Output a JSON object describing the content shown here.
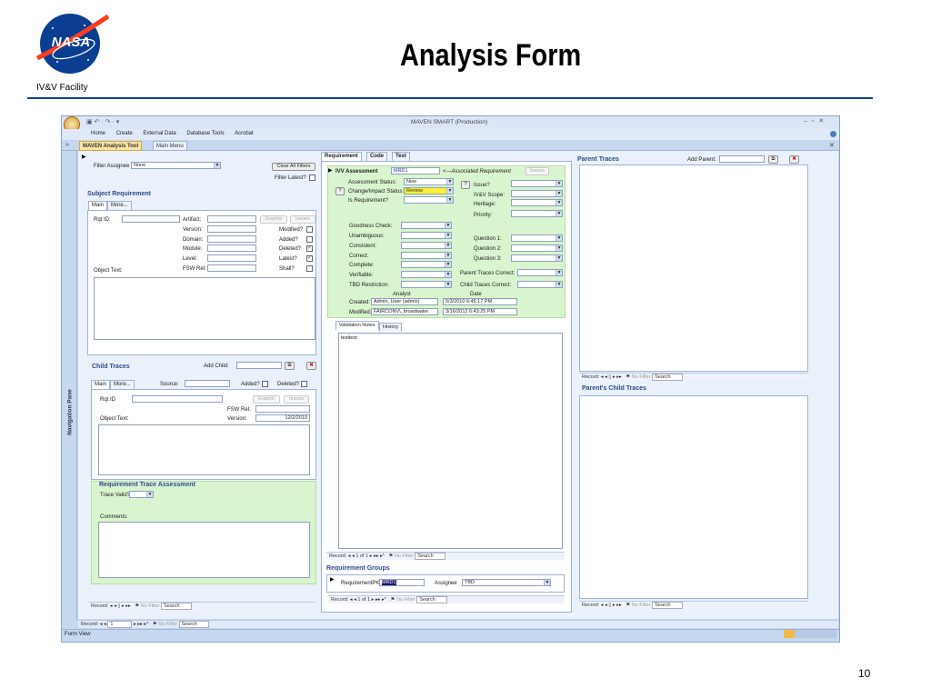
{
  "slide": {
    "title": "Analysis Form",
    "facility": "IV&V Facility",
    "logo_text": "NASA",
    "page_number": "10"
  },
  "app": {
    "window_title": "MAVEN SMART (Production)",
    "ribbon": [
      "Home",
      "Create",
      "External Data",
      "Database Tools",
      "Acrobat"
    ],
    "doc_tabs": [
      "MAVEN Analysis Tool",
      "Main Menu"
    ],
    "nav_pane": "Navigation Pane",
    "status": "Form View",
    "record_bar": {
      "label": "Record:",
      "value": "1",
      "filter": "No Filter",
      "search": "Search"
    }
  },
  "left": {
    "filter_assignee_label": "Filter Assignee",
    "filter_assignee_value": "None",
    "clear_filters": "Clear All Filters",
    "filter_latest": "Filter Latest?",
    "subject_title": "Subject Requirement",
    "tabs": [
      "Main",
      "More..."
    ],
    "rqt_id": "Rqt ID:",
    "artifact": "Artifact:",
    "version": "Version:",
    "domain": "Domain:",
    "module": "Module:",
    "level": "Level:",
    "fsw_rel": "FSW Rel:",
    "object_text": "Object Text:",
    "graphic": "Graphic",
    "issues": "Issues",
    "modified": "Modified?",
    "added": "Added?",
    "deleted": "Deleted?",
    "latest": "Latest?",
    "shall": "Shall?",
    "child_title": "Child Traces",
    "add_child": "Add Child:",
    "source": "Source:",
    "child_added": "Added?",
    "child_deleted": "Deleted?",
    "child_rqt_id": "Rqt ID",
    "child_fsw": "FSW Rel:",
    "child_version": "Version:",
    "child_version_value": "12/2/2010",
    "child_object": "Object Text:",
    "assess_title": "Requirement Trace Assessment",
    "trace_valid": "Trace Valid?",
    "comments": "Comments:"
  },
  "middle": {
    "tabs": [
      "Requirement",
      "Code",
      "Test"
    ],
    "ivv_label": "IVV Assessment",
    "ivv_value": "MRD1",
    "assoc": "<---Associated Requirement",
    "issues": "Issues",
    "assessment_status": "Assessment Status:",
    "assessment_status_value": "New",
    "change_impact": "Change/Impact Status:",
    "change_impact_value": "Review",
    "is_requirement": "Is Requirement?",
    "issue": "Issue?",
    "ivv_scope": "IV&V Scope:",
    "heritage": "Heritage:",
    "priority": "Priority:",
    "goodness": "Goodness Check:",
    "unambiguous": "Unambiguous:",
    "consistent": "Consistent:",
    "correct": "Correct:",
    "complete": "Complete:",
    "verifiable": "Verifiable:",
    "tbd_restriction": "TBD Restriction:",
    "q1": "Question 1:",
    "q2": "Question 2:",
    "q3": "Question 3:",
    "parent_correct": "Parent Traces Correct:",
    "child_correct": "Child Traces Correct:",
    "analyst": "Analyst",
    "date": "Date",
    "created": "Created:",
    "created_by": "Admin, User (admin)",
    "created_date": "5/3/2010 6:46:17 PM",
    "modified": "Modified:",
    "modified_by": "FAIRCONV\\_broadwater",
    "modified_date": "3/16/2012 6:43:25 PM",
    "note_tabs": [
      "Validation Notes",
      "History"
    ],
    "notes_text": "testtest",
    "record1": "Record:",
    "record1_value": "1 of 1",
    "groups_title": "Requirement Groups",
    "req_pk": "RequirementPK",
    "req_pk_value": "MRD1",
    "assignee": "Assignee",
    "assignee_value": "TBD",
    "record2_value": "1 of 1"
  },
  "right": {
    "parent_title": "Parent Traces",
    "add_parent": "Add Parent:",
    "parent_child_title": "Parent's Child Traces"
  }
}
